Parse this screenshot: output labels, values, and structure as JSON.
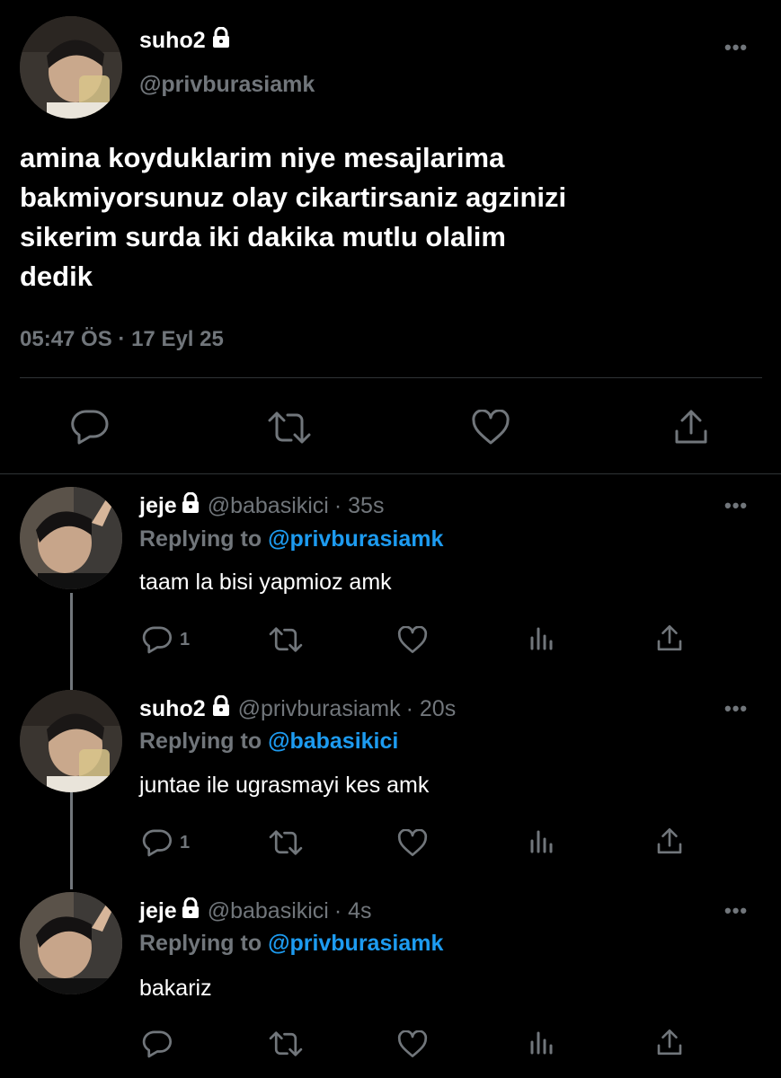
{
  "main_tweet": {
    "display_name": "suho2",
    "handle": "@privburasiamk",
    "text_lines": [
      "amina koyduklarim niye mesajlarima",
      "bakmiyorsunuz olay cikartirsaniz agzinizi",
      "sikerim surda iki dakika mutlu olalim",
      "dedik"
    ],
    "time": "05:47 ÖS",
    "separator": "·",
    "date": "17 Eyl 25",
    "more": "•••"
  },
  "replies": [
    {
      "display_name": "jeje",
      "handle": "@babasikici",
      "age": "· 35s",
      "replying_prefix": "Replying to",
      "replying_to": "@privburasiamk",
      "text": "taam la bisi yapmioz amk",
      "reply_count": "1",
      "more": "•••"
    },
    {
      "display_name": "suho2",
      "handle": "@privburasiamk",
      "age": "· 20s",
      "replying_prefix": "Replying to",
      "replying_to": "@babasikici",
      "text": "juntae ile ugrasmayi kes amk",
      "reply_count": "1",
      "more": "•••"
    },
    {
      "display_name": "jeje",
      "handle": "@babasikici",
      "age": "· 4s",
      "replying_prefix": "Replying to",
      "replying_to": "@privburasiamk",
      "text": "bakariz",
      "reply_count": "",
      "more": "•••"
    }
  ],
  "colors": {
    "background": "#000000",
    "muted": "#71767b",
    "link": "#1d9bf0",
    "divider": "#2f3336"
  }
}
